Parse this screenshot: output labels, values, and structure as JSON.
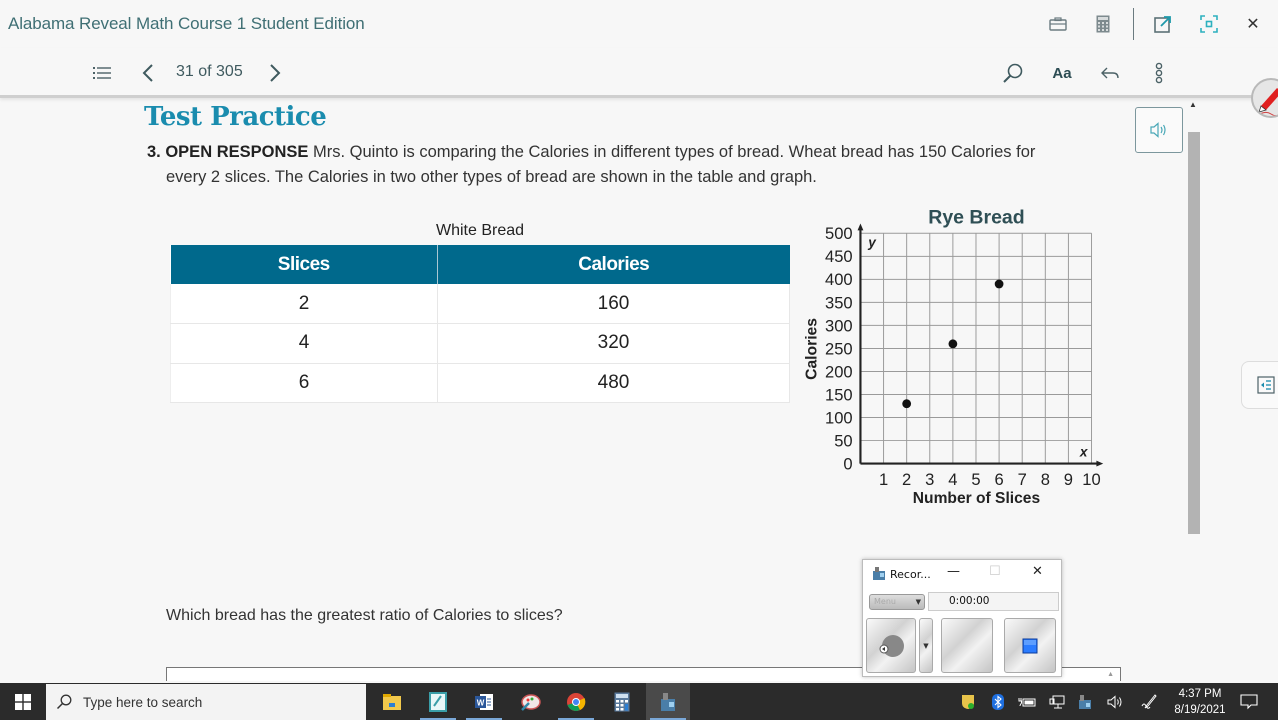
{
  "app": {
    "title": "Alabama Reveal Math Course 1 Student Edition"
  },
  "nav": {
    "page_indicator": "31 of 305",
    "font_button_label": "Aa"
  },
  "header_icons": [
    "toolbox-icon",
    "calculator-icon",
    "open-external-icon",
    "focus-mode-icon",
    "close-icon"
  ],
  "nav_icons": [
    "table-of-contents-icon",
    "previous-page-icon",
    "next-page-icon",
    "search-icon",
    "font-size-icon",
    "back-icon",
    "more-options-icon"
  ],
  "content": {
    "section_title": "Test Practice",
    "question": {
      "number_label": "3. OPEN RESPONSE",
      "line1": " Mrs. Quinto is comparing the Calories in different types of bread. Wheat bread has 150 Calories for",
      "line2": "every 2 slices. The Calories in two other types of bread are shown in the table and graph."
    },
    "white_bread_table": {
      "title": "White Bread",
      "headers": [
        "Slices",
        "Calories"
      ],
      "rows": [
        [
          "2",
          "160"
        ],
        [
          "4",
          "320"
        ],
        [
          "6",
          "480"
        ]
      ]
    },
    "prompt": "Which bread has the greatest ratio of Calories to slices?",
    "answer_value": ""
  },
  "chart_data": {
    "type": "scatter",
    "title": "Rye Bread",
    "xlabel": "Number of Slices",
    "ylabel": "Calories",
    "x_axis_letter": "x",
    "y_axis_letter": "y",
    "xlim": [
      0,
      10
    ],
    "ylim": [
      0,
      500
    ],
    "x_ticks": [
      1,
      2,
      3,
      4,
      5,
      6,
      7,
      8,
      9,
      10
    ],
    "y_ticks": [
      0,
      50,
      100,
      150,
      200,
      250,
      300,
      350,
      400,
      450,
      500
    ],
    "grid": true,
    "series": [
      {
        "name": "Rye Bread",
        "points": [
          {
            "x": 2,
            "y": 130
          },
          {
            "x": 4,
            "y": 260
          },
          {
            "x": 6,
            "y": 390
          }
        ]
      }
    ]
  },
  "recorder": {
    "title": "Recor...",
    "menu_label": "Menu",
    "time": "0:00:00",
    "minimize_label": "—",
    "maximize_label": "☐",
    "close_label": "✕"
  },
  "taskbar": {
    "search_placeholder": "Type here to search",
    "apps": [
      "file-explorer",
      "sticky-notes",
      "word",
      "paint",
      "chrome",
      "calculator",
      "recorder"
    ],
    "clock_time": "4:37 PM",
    "clock_date": "8/19/2021"
  }
}
